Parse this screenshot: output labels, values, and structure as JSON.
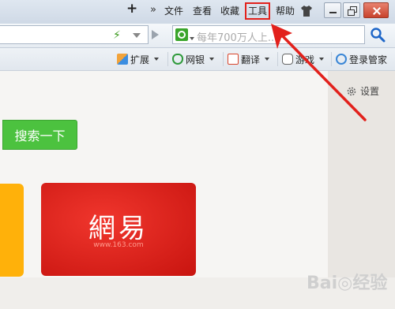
{
  "menubar": {
    "plus": "+",
    "more": "»",
    "items": [
      "文件",
      "查看",
      "收藏",
      "工具",
      "帮助"
    ]
  },
  "addressbar": {
    "search_placeholder": "每年700万人上..."
  },
  "toolbar": {
    "items": [
      {
        "label": "扩展",
        "icon": "extension-icon",
        "caret": true
      },
      {
        "label": "网银",
        "icon": "shield-bank-icon",
        "caret": true
      },
      {
        "label": "翻译",
        "icon": "translate-icon",
        "caret": true
      },
      {
        "label": "游戏",
        "icon": "gamepad-icon",
        "caret": true
      },
      {
        "label": "登录管家",
        "icon": "login-key-icon",
        "caret": false
      }
    ]
  },
  "content": {
    "settings_label": "设置",
    "search_button": "搜索一下",
    "tile_title": "網易",
    "tile_url": "www.163.com"
  },
  "watermark": "Bai◎经验",
  "colors": {
    "highlight": "#e2211c",
    "search_button": "#4cc23f",
    "tile_red": "#e1231b",
    "tile_yellow": "#ffb10a"
  }
}
